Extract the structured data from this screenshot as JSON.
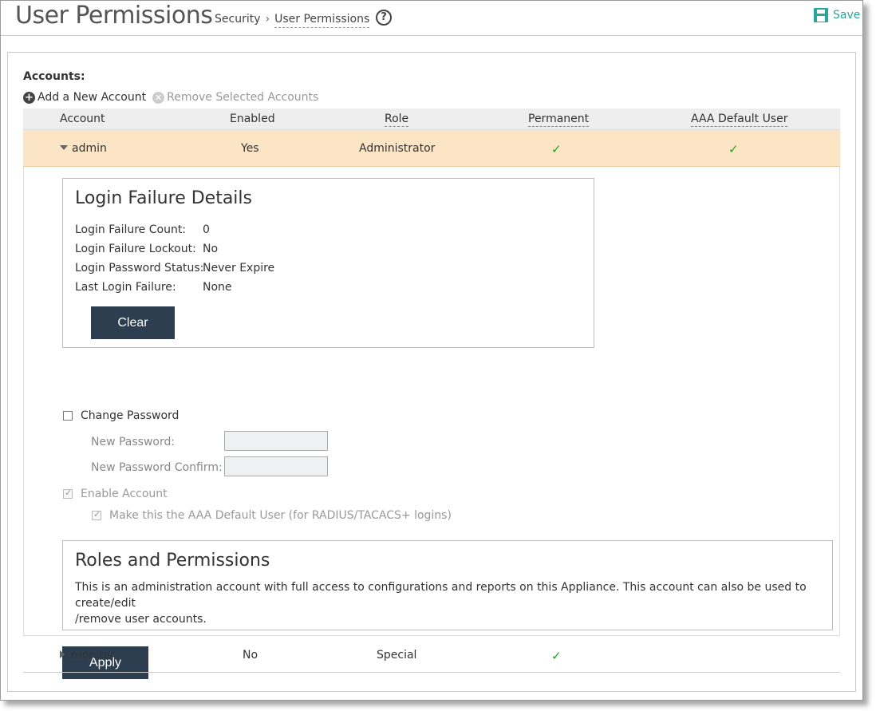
{
  "header": {
    "title": "User Permissions",
    "breadcrumb": [
      "Security",
      "User Permissions"
    ],
    "help_glyph": "?",
    "save_label": "Save"
  },
  "accounts": {
    "label": "Accounts:",
    "add_label": "Add a New Account",
    "remove_label": "Remove Selected Accounts",
    "columns": [
      "Account",
      "Enabled",
      "Role",
      "Permanent",
      "AAA Default User"
    ],
    "rows": [
      {
        "account": "admin",
        "enabled": "Yes",
        "role": "Administrator",
        "permanent": true,
        "aaa_default": true,
        "expanded": true
      },
      {
        "account": "monitor",
        "enabled": "No",
        "role": "Special",
        "permanent": true,
        "aaa_default": false,
        "expanded": false
      }
    ]
  },
  "login_failure": {
    "title": "Login Failure Details",
    "items": [
      {
        "label": "Login Failure Count:",
        "value": "0"
      },
      {
        "label": "Login Failure Lockout:",
        "value": "No"
      },
      {
        "label": "Login Password Status:",
        "value": "Never Expire"
      },
      {
        "label": "Last Login Failure:",
        "value": "None"
      }
    ],
    "clear_label": "Clear"
  },
  "password": {
    "change_label": "Change Password",
    "change_checked": false,
    "new_label": "New Password:",
    "new_value": "",
    "confirm_label": "New Password Confirm:",
    "confirm_value": ""
  },
  "options": {
    "enable_account_label": "Enable Account",
    "enable_account_checked": true,
    "aaa_default_label": "Make this the AAA Default User (for RADIUS/TACACS+ logins)",
    "aaa_default_checked": true
  },
  "roles": {
    "title": "Roles and Permissions",
    "text_line1": "This is an administration account with full access to configurations and reports on this Appliance. This account can also be used to create/edit",
    "text_line2": "/remove user accounts."
  },
  "apply_label": "Apply",
  "check_glyph": "✓",
  "colors": {
    "accent": "#23a89a",
    "selected_row": "#fbe5c5",
    "dark_button": "#2c3e50",
    "check": "#1aa51a"
  },
  "icons": {
    "save": "floppy-disk-icon",
    "help": "question-circle-icon",
    "add": "plus-circle-icon",
    "remove": "x-circle-icon",
    "expand": "triangle-down-icon",
    "collapse": "triangle-right-icon"
  }
}
